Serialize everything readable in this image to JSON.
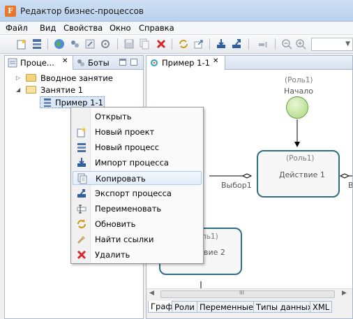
{
  "window": {
    "title": "Редактор бизнес-процессов",
    "icon": "app-logo-icon"
  },
  "menubar": [
    {
      "label": "Файл"
    },
    {
      "label": "Вид"
    },
    {
      "label": "Свойства"
    },
    {
      "label": "Окно"
    },
    {
      "label": "Справка"
    }
  ],
  "left_panel": {
    "tabs": [
      {
        "label": "Проце..."
      },
      {
        "label": "Боты"
      }
    ],
    "tree": [
      {
        "label": "Вводное занятие",
        "expanded": false
      },
      {
        "label": "Занятие 1",
        "expanded": true
      },
      {
        "label": "Пример 1-1",
        "selected": true
      }
    ]
  },
  "editor": {
    "tab_label": "Пример 1-1",
    "diagram": {
      "start_role": "(Роль1)",
      "start_label": "Начало",
      "action1_role": "(Роль1)",
      "action1_label": "Действие 1",
      "choice_label": "Выбор1",
      "right_cut_label": "В",
      "action2_role": "ль1)",
      "action2_label": "вие 2"
    },
    "bottom_tabs": [
      "Граф",
      "Роли",
      "Переменные",
      "Типы данных",
      "XML"
    ],
    "scroll_grip": "III"
  },
  "context_menu": [
    {
      "label": "Открыть",
      "icon": "none"
    },
    {
      "label": "Новый проект",
      "icon": "new-project-icon"
    },
    {
      "label": "Новый процесс",
      "icon": "new-process-icon"
    },
    {
      "label": "Импорт процесса",
      "icon": "import-icon"
    },
    {
      "label": "Копировать",
      "icon": "copy-icon",
      "hovered": true
    },
    {
      "label": "Экспорт процесса",
      "icon": "export-icon"
    },
    {
      "label": "Переименовать",
      "icon": "rename-icon"
    },
    {
      "label": "Обновить",
      "icon": "refresh-icon"
    },
    {
      "label": "Найти ссылки",
      "icon": "find-references-icon"
    },
    {
      "label": "Удалить",
      "icon": "delete-icon"
    }
  ],
  "colors": {
    "node_border": "#2f6e84",
    "start_fill": "#a7d77a",
    "menu_hover": "#e3edfa"
  }
}
